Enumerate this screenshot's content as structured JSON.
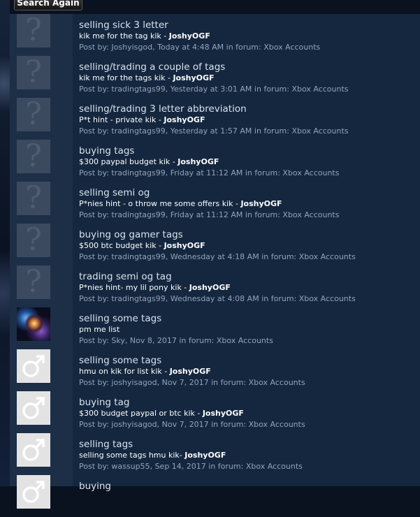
{
  "search_again_label": "Search Again",
  "labels": {
    "post_by": "Post by: ",
    "in_forum": " in forum: "
  },
  "results": [
    {
      "title": "selling sick 3 letter",
      "snippet": "kik me for the tag kik - ",
      "highlight": "JoshyOGF",
      "author": "Joshyisgod",
      "time": "Today at 4:48 AM",
      "forum": "Xbox Accounts",
      "avatar": "question-icon"
    },
    {
      "title": "selling/trading a couple of tags",
      "snippet": "kik me for the tags kik - ",
      "highlight": "JoshyOGF",
      "author": "tradingtags99",
      "time": "Yesterday at 3:01 AM",
      "forum": "Xbox Accounts",
      "avatar": "question-icon"
    },
    {
      "title": "selling/trading 3 letter abbreviation",
      "snippet": "P*t hint - private kik - ",
      "highlight": "JoshyOGF",
      "author": "tradingtags99",
      "time": "Yesterday at 1:57 AM",
      "forum": "Xbox Accounts",
      "avatar": "question-icon"
    },
    {
      "title": "buying tags",
      "snippet": "$300 paypal budget kik - ",
      "highlight": "JoshyOGF",
      "author": "tradingtags99",
      "time": "Friday at 11:12 AM",
      "forum": "Xbox Accounts",
      "avatar": "question-icon"
    },
    {
      "title": "selling semi og",
      "snippet": "P*nies hint - o throw me some offers kik - ",
      "highlight": "JoshyOGF",
      "author": "tradingtags99",
      "time": "Friday at 11:12 AM",
      "forum": "Xbox Accounts",
      "avatar": "question-icon"
    },
    {
      "title": "buying og gamer tags",
      "snippet": "$500 btc budget kik - ",
      "highlight": "JoshyOGF",
      "author": "tradingtags99",
      "time": "Wednesday at 4:18 AM",
      "forum": "Xbox Accounts",
      "avatar": "question-icon"
    },
    {
      "title": "trading semi og tag",
      "snippet": "P*nies hint- my lil pony kik - ",
      "highlight": "JoshyOGF",
      "author": "tradingtags99",
      "time": "Wednesday at 4:08 AM",
      "forum": "Xbox Accounts",
      "avatar": "question-icon"
    },
    {
      "title": "selling some tags",
      "snippet": "pm me list",
      "highlight": "",
      "author": "Sky",
      "time": "Nov 8, 2017",
      "forum": "Xbox Accounts",
      "avatar": "custom-avatar"
    },
    {
      "title": "selling some tags",
      "snippet": "hmu on kik for list kik - ",
      "highlight": "JoshyOGF",
      "author": "joshyisagod",
      "time": "Nov 7, 2017",
      "forum": "Xbox Accounts",
      "avatar": "male-icon"
    },
    {
      "title": "buying tag",
      "snippet": "$300 budget paypal or btc kik - ",
      "highlight": "JoshyOGF",
      "author": "joshyisagod",
      "time": "Nov 7, 2017",
      "forum": "Xbox Accounts",
      "avatar": "male-icon"
    },
    {
      "title": "selling tags",
      "snippet": "selling some tags hmu kik- ",
      "highlight": "JoshyOGF",
      "author": "wassup55",
      "time": "Sep 14, 2017",
      "forum": "Xbox Accounts",
      "avatar": "male-icon"
    },
    {
      "title": "buying",
      "snippet": "",
      "highlight": "",
      "author": "",
      "time": "",
      "forum": "",
      "avatar": "male-icon"
    }
  ]
}
